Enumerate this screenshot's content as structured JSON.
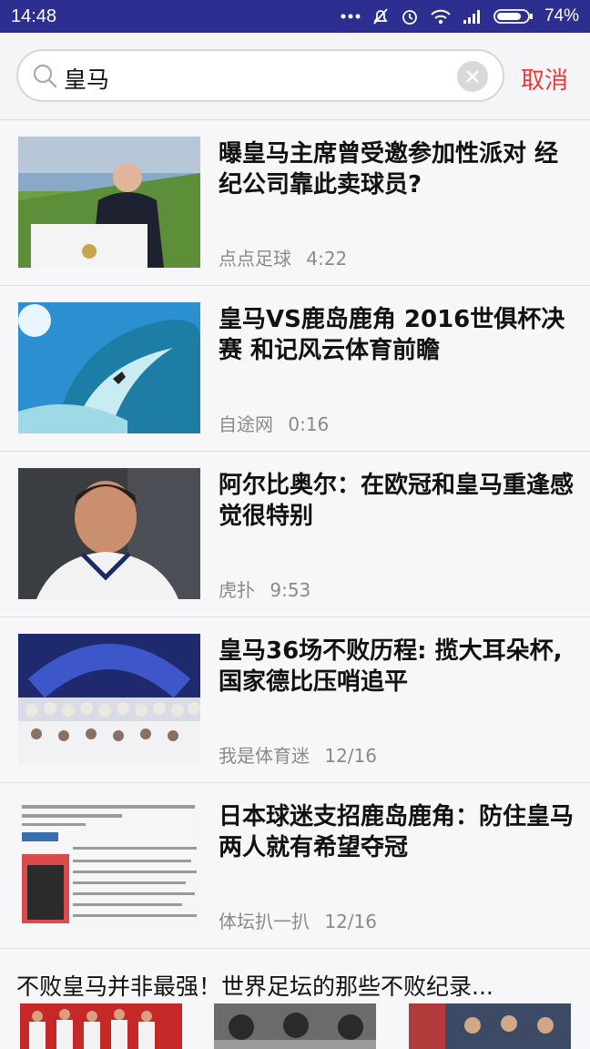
{
  "status_bar": {
    "time": "14:48",
    "battery": "74%",
    "icons": [
      "more-dots-icon",
      "mute-bell-icon",
      "alarm-icon",
      "wifi-icon",
      "signal-icon",
      "battery-icon"
    ]
  },
  "search": {
    "query": "皇马",
    "cancel_label": "取消"
  },
  "news": [
    {
      "title": "曝皇马主席曾受邀参加性派对 经纪公司靠此卖球员?",
      "source": "点点足球",
      "time": "4:22"
    },
    {
      "title": "皇马VS鹿岛鹿角 2016世俱杯决赛 和记风云体育前瞻",
      "source": "自途网",
      "time": "0:16"
    },
    {
      "title": "阿尔比奥尔：在欧冠和皇马重逢感觉很特别",
      "source": "虎扑",
      "time": "9:53"
    },
    {
      "title": "皇马36场不败历程: 揽大耳朵杯, 国家德比压哨追平",
      "source": "我是体育迷",
      "time": "12/16"
    },
    {
      "title": "日本球迷支招鹿岛鹿角：防住皇马两人就有希望夺冠",
      "source": "体坛扒一扒",
      "time": "12/16"
    }
  ],
  "gallery": {
    "title": "不败皇马并非最强！世界足坛的那些不败纪录..."
  },
  "colors": {
    "status_bar": "#2c2f8f",
    "cancel": "#e83c3c",
    "meta": "#8a8a8a"
  }
}
